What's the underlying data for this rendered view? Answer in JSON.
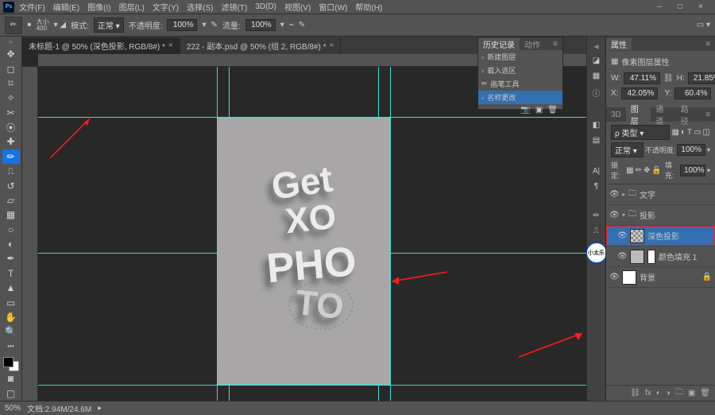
{
  "menubar": {
    "items": [
      "文件(F)",
      "编辑(E)",
      "图像(I)",
      "图层(L)",
      "文字(Y)",
      "选择(S)",
      "滤镜(T)",
      "3D(D)",
      "视图(V)",
      "窗口(W)",
      "帮助(H)"
    ]
  },
  "optionbar": {
    "size_label": "大小",
    "size_val": "400",
    "mode_label": "模式:",
    "mode_val": "正常",
    "opacity_label": "不透明度:",
    "opacity_val": "100%",
    "flow_label": "流量:",
    "flow_val": "100%"
  },
  "doc_tabs": [
    {
      "label": "未标题-1 @ 50% (深色投影, RGB/8#) *"
    },
    {
      "label": "222 - 副本.psd @ 50% (组 2, RGB/8#) *"
    }
  ],
  "status": {
    "zoom": "50%",
    "doc_info": "文档:2.94M/24.6M"
  },
  "history": {
    "tabs": [
      "历史记录",
      "动作"
    ],
    "items": [
      "新建图层",
      "载入选区",
      "画笔工具",
      "名称更改"
    ]
  },
  "properties": {
    "tab": "属性",
    "title": "像素图层属性",
    "w_label": "W:",
    "w_val": "47.11%",
    "h_label": "H:",
    "h_val": "21.85%",
    "x_label": "X:",
    "x_val": "42.05%",
    "y_label": "Y:",
    "y_val": "60.4%"
  },
  "layers_panel": {
    "tabs": [
      "3D",
      "图层",
      "通道",
      "路径"
    ],
    "kind_label": "ρ 类型",
    "blend_val": "正常",
    "opacity_label": "不透明度:",
    "opacity_val": "100%",
    "lock_label": "锁定:",
    "fill_label": "填充:",
    "fill_val": "100%",
    "layers": [
      {
        "name": "文字",
        "type": "group"
      },
      {
        "name": "投影",
        "type": "group"
      },
      {
        "name": "深色投影",
        "type": "px",
        "selected": true,
        "red": true
      },
      {
        "name": "颜色填充 1",
        "type": "fill"
      },
      {
        "name": "背景",
        "type": "bg"
      }
    ]
  },
  "artboard_text": {
    "l1": "Get",
    "l2": "XO",
    "l3": "PHO",
    "l4": "TO"
  },
  "deer_label": "小太乐"
}
